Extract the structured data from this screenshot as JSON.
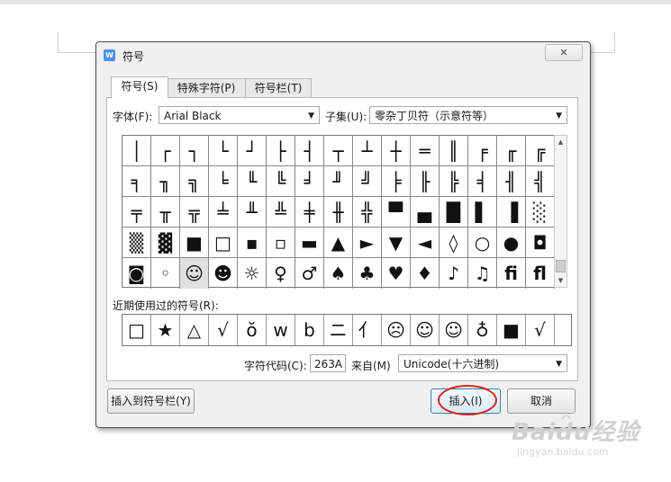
{
  "dialog": {
    "title": "符号",
    "close_glyph": "✕"
  },
  "tabs": [
    {
      "label": "符号(S)"
    },
    {
      "label": "特殊字符(P)"
    },
    {
      "label": "符号栏(T)"
    }
  ],
  "font": {
    "label": "字体(F):",
    "value": "Arial Black"
  },
  "subset": {
    "label": "子集(U):",
    "value": "零杂丁贝符（示意符等）"
  },
  "symbols": [
    "│",
    "┌",
    "┐",
    "└",
    "┘",
    "├",
    "┤",
    "┬",
    "┴",
    "┼",
    "═",
    "║",
    "╒",
    "╓",
    "╔",
    "╕",
    "╖",
    "╗",
    "╘",
    "╙",
    "╚",
    "╛",
    "╜",
    "╝",
    "╞",
    "╟",
    "╠",
    "╡",
    "╢",
    "╣",
    "╤",
    "╥",
    "╦",
    "╧",
    "╨",
    "╩",
    "╪",
    "╫",
    "╬",
    "▀",
    "▄",
    "█",
    "▌",
    "▐",
    "░",
    "▒",
    "▓",
    "■",
    "□",
    "▪",
    "▫",
    "▬",
    "▲",
    "►",
    "▼",
    "◄",
    "◊",
    "○",
    "●",
    "◘",
    "◙",
    "◦",
    "☺",
    "☻",
    "☼",
    "♀",
    "♂",
    "♠",
    "♣",
    "♥",
    "♦",
    "♪",
    "♫",
    "fi",
    "fl"
  ],
  "recent": {
    "label": "近期使用过的符号(R):",
    "items": [
      "□",
      "★",
      "△",
      "√",
      "ŏ",
      "w",
      "b",
      "ニ",
      "亻",
      "☹",
      "☺",
      "☺",
      "♁",
      "■",
      "√"
    ]
  },
  "charcode": {
    "label": "字符代码(C):",
    "value": "263A"
  },
  "from": {
    "label": "来自(M)",
    "value": "Unicode(十六进制)"
  },
  "buttons": {
    "add_to_bar": "插入到符号栏(Y)",
    "insert": "插入(I)",
    "cancel": "取消"
  },
  "watermark": {
    "main": "Baidu经验",
    "sub": "jingyan.baidu.com"
  }
}
